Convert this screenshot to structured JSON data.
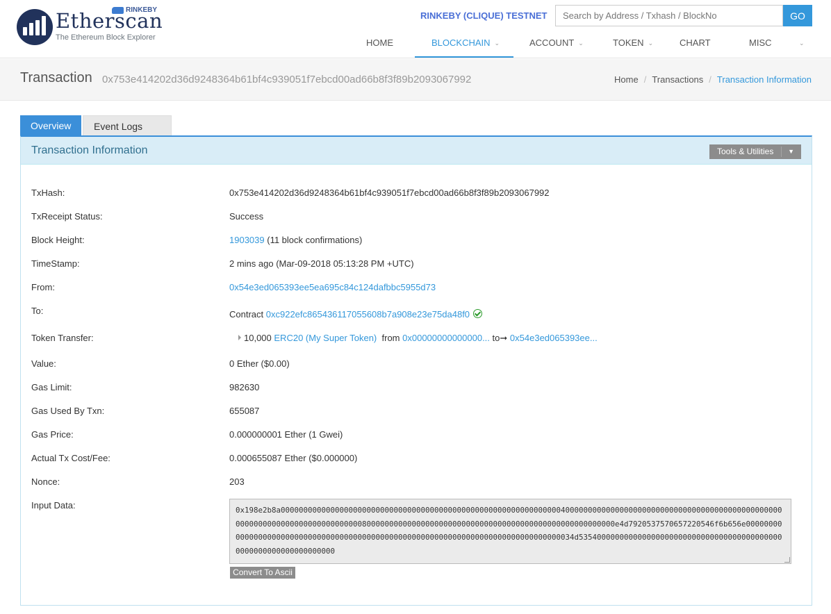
{
  "header": {
    "logo_text": "Etherscan",
    "logo_subtitle": "The Ethereum Block Explorer",
    "badge": "RINKEBY",
    "network_label": "RINKEBY (CLIQUE) TESTNET",
    "search_placeholder": "Search by Address / Txhash / BlockNo",
    "go_label": "GO"
  },
  "nav": {
    "items": [
      {
        "label": "HOME"
      },
      {
        "label": "BLOCKCHAIN"
      },
      {
        "label": "ACCOUNT"
      },
      {
        "label": "TOKEN"
      },
      {
        "label": "CHART"
      },
      {
        "label": "MISC"
      }
    ],
    "active": "BLOCKCHAIN"
  },
  "page": {
    "title": "Transaction",
    "hash": "0x753e414202d36d9248364b61bf4c939051f7ebcd00ad66b8f3f89b2093067992"
  },
  "breadcrumb": {
    "home": "Home",
    "transactions": "Transactions",
    "current": "Transaction Information"
  },
  "tabs": {
    "overview": "Overview",
    "event_logs": "Event Logs"
  },
  "panel": {
    "title": "Transaction Information",
    "tools_label": "Tools & Utilities"
  },
  "fields": {
    "txhash": {
      "label": "TxHash:",
      "value": "0x753e414202d36d9248364b61bf4c939051f7ebcd00ad66b8f3f89b2093067992"
    },
    "status": {
      "label": "TxReceipt Status:",
      "value": "Success"
    },
    "block": {
      "label": "Block Height:",
      "number": "1903039",
      "confirmations": "(11 block confirmations)"
    },
    "timestamp": {
      "label": "TimeStamp:",
      "value": "2 mins ago (Mar-09-2018 05:13:28 PM +UTC)"
    },
    "from": {
      "label": "From:",
      "value": "0x54e3ed065393ee5ea695c84c124dafbbc5955d73"
    },
    "to": {
      "label": "To:",
      "prefix": "Contract",
      "value": "0xc922efc865436117055608b7a908e23e75da48f0"
    },
    "token_transfer": {
      "label": "Token Transfer:",
      "amount": "10,000",
      "token": "ERC20 (My Super Token)",
      "from_word": "from",
      "from_addr": "0x00000000000000...",
      "to_word": "to",
      "arrow": "➞",
      "to_addr": "0x54e3ed065393ee..."
    },
    "value": {
      "label": "Value:",
      "value": "0 Ether ($0.00)"
    },
    "gas_limit": {
      "label": "Gas Limit:",
      "value": "982630"
    },
    "gas_used": {
      "label": "Gas Used By Txn:",
      "value": "655087"
    },
    "gas_price": {
      "label": "Gas Price:",
      "value": "0.000000001 Ether (1 Gwei)"
    },
    "fee": {
      "label": "Actual Tx Cost/Fee:",
      "value": "0.000655087 Ether ($0.000000)"
    },
    "nonce": {
      "label": "Nonce:",
      "value": "203"
    },
    "input_data": {
      "label": "Input Data:",
      "value": "0x198e2b8a000000000000000000000000000000000000000000000000000000000000004000000000000000000000000000000000000000000000000000000000000000000000000000080000000000000000000000000000000000000000000000000000000e4d7920537570657220546f6b656e00000000000000000000000000000000000000000000000000000000000000000000000000000000034d5354000000000000000000000000000000000000000000000000000000000000000",
      "convert_label": "Convert To Ascii"
    }
  }
}
